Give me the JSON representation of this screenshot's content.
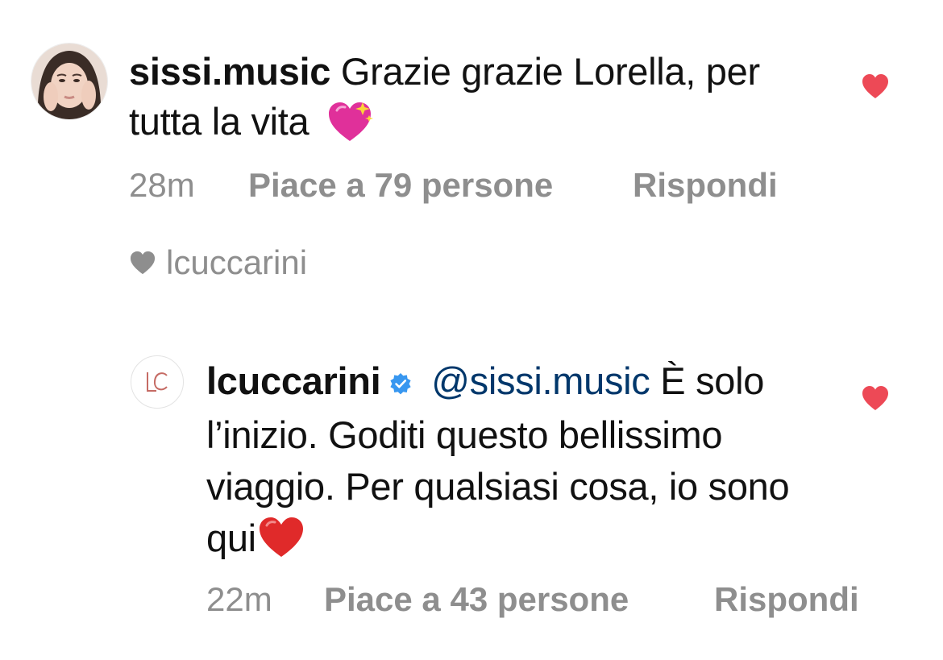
{
  "comment": {
    "username": "sissi.music",
    "text": "Grazie grazie Lorella, per tutta la vita",
    "emoji": "sparkling-heart-icon",
    "time": "28m",
    "likes": "Piace a 79 persone",
    "reply_label": "Rispondi",
    "liked_by": "lcuccarini"
  },
  "reply": {
    "username": "lcuccarini",
    "verified": true,
    "mention": "@sissi.music",
    "text": "È solo l’inizio. Goditi questo bellissimo viaggio. Per qualsiasi cosa, io sono qui",
    "emoji": "red-heart-icon",
    "time": "22m",
    "likes": "Piace a 43 persone",
    "reply_label": "Rispondi"
  },
  "colors": {
    "like_red": "#ed4956",
    "meta_gray": "#8e8e8e",
    "mention_blue": "#00376b",
    "verified_blue": "#3897f0"
  }
}
